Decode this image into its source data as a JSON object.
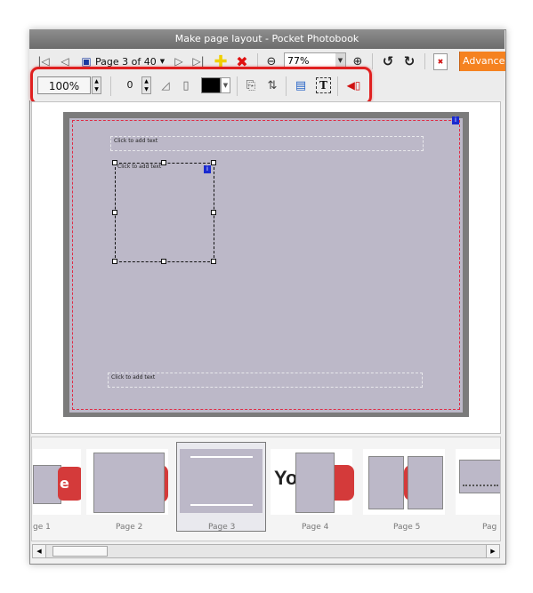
{
  "window": {
    "title": "Make page layout - Pocket Photobook"
  },
  "toolbar": {
    "page_label": "Page 3 of 40",
    "zoom_value": "77%",
    "advance_label": "Advance"
  },
  "format_bar": {
    "scale_value": "100%",
    "border_width": "0",
    "border_color": "#000000"
  },
  "page": {
    "title_placeholder": "Click to add text",
    "photo_caption": "Click to add text",
    "footer_placeholder": "Click to add text",
    "background_color": "#bcb8c8",
    "border_color": "#e02a44"
  },
  "filmstrip": {
    "pages": [
      {
        "label": "ge 1"
      },
      {
        "label": "Page 2"
      },
      {
        "label": "Page 3",
        "selected": true
      },
      {
        "label": "Page 4"
      },
      {
        "label": "Page 5"
      },
      {
        "label": "Pag"
      }
    ]
  },
  "colors": {
    "accent": "#f58220",
    "highlight": "#e02020",
    "selection": "#1a2ad0"
  }
}
